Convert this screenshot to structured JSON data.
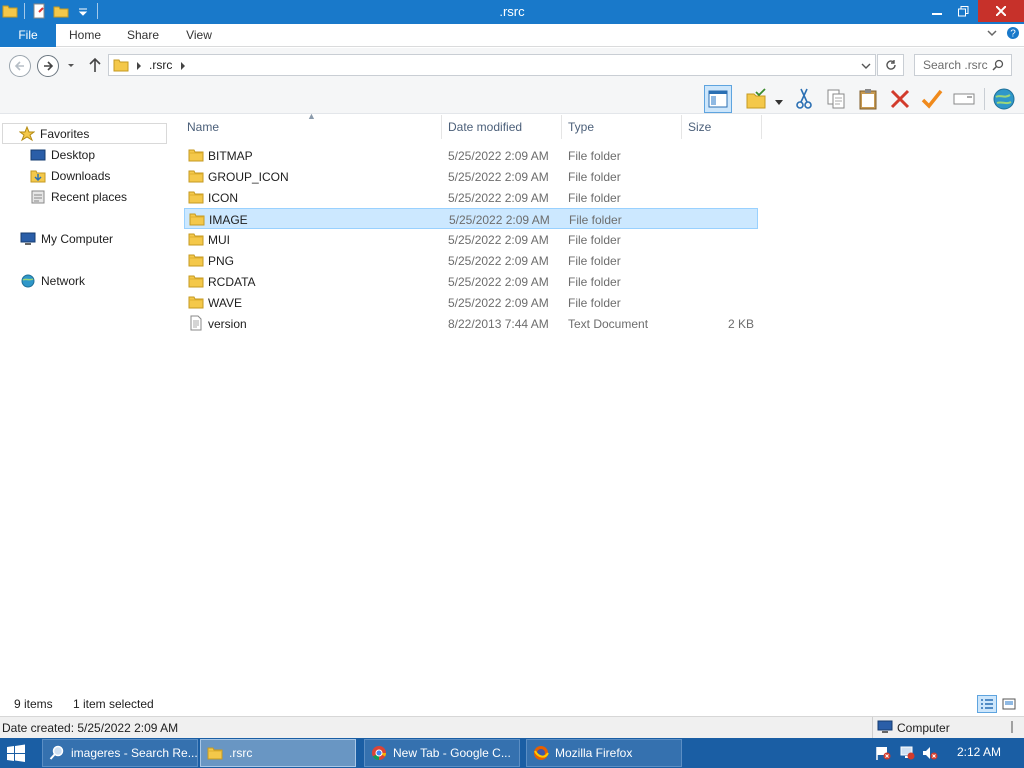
{
  "window": {
    "title": ".rsrc"
  },
  "ribbon": {
    "tabs": [
      {
        "label": "File"
      },
      {
        "label": "Home"
      },
      {
        "label": "Share"
      },
      {
        "label": "View"
      }
    ]
  },
  "address": {
    "path": [
      ".rsrc"
    ],
    "search_placeholder": "Search .rsrc"
  },
  "navigation": {
    "favorites_label": "Favorites",
    "favorites": [
      {
        "label": "Desktop"
      },
      {
        "label": "Downloads"
      },
      {
        "label": "Recent places"
      }
    ],
    "computer_label": "My Computer",
    "network_label": "Network"
  },
  "file_list": {
    "columns": [
      "Name",
      "Date modified",
      "Type",
      "Size"
    ],
    "rows": [
      {
        "name": "BITMAP",
        "date": "5/25/2022 2:09 AM",
        "type": "File folder",
        "size": "",
        "icon": "folder-icon"
      },
      {
        "name": "GROUP_ICON",
        "date": "5/25/2022 2:09 AM",
        "type": "File folder",
        "size": "",
        "icon": "folder-icon"
      },
      {
        "name": "ICON",
        "date": "5/25/2022 2:09 AM",
        "type": "File folder",
        "size": "",
        "icon": "folder-icon"
      },
      {
        "name": "IMAGE",
        "date": "5/25/2022 2:09 AM",
        "type": "File folder",
        "size": "",
        "icon": "folder-icon",
        "selected": true
      },
      {
        "name": "MUI",
        "date": "5/25/2022 2:09 AM",
        "type": "File folder",
        "size": "",
        "icon": "folder-icon"
      },
      {
        "name": "PNG",
        "date": "5/25/2022 2:09 AM",
        "type": "File folder",
        "size": "",
        "icon": "folder-icon"
      },
      {
        "name": "RCDATA",
        "date": "5/25/2022 2:09 AM",
        "type": "File folder",
        "size": "",
        "icon": "folder-icon"
      },
      {
        "name": "WAVE",
        "date": "5/25/2022 2:09 AM",
        "type": "File folder",
        "size": "",
        "icon": "folder-icon"
      },
      {
        "name": "version",
        "date": "8/22/2013 7:44 AM",
        "type": "Text Document",
        "size": "2 KB",
        "icon": "text-document-icon"
      }
    ]
  },
  "status": {
    "item_count": "9 items",
    "selection": "1 item selected",
    "date_created": "Date created: 5/25/2022 2:09 AM",
    "location": "Computer"
  },
  "taskbar": {
    "buttons": [
      {
        "label": "imageres - Search Re...",
        "icon": "search-icon"
      },
      {
        "label": ".rsrc",
        "icon": "folder-icon",
        "active": true
      },
      {
        "label": "New Tab - Google C...",
        "icon": "chrome-icon"
      },
      {
        "label": "Mozilla Firefox",
        "icon": "firefox-icon"
      }
    ],
    "clock": "2:12 AM"
  },
  "colors": {
    "accent": "#1979ca",
    "selection": "#cce8ff",
    "taskbar": "#1a5ea4"
  }
}
